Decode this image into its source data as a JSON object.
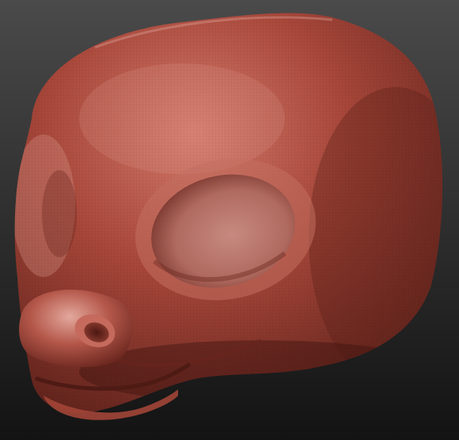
{
  "viewport": {
    "background_top": "#4a4a4a",
    "background_bottom": "#131313"
  },
  "model": {
    "kind": "sculpted creature head",
    "material_base": "#a8473a",
    "material_shadow": "#5e221b",
    "material_highlight": "#e0a094",
    "wireframe_visible": true
  }
}
